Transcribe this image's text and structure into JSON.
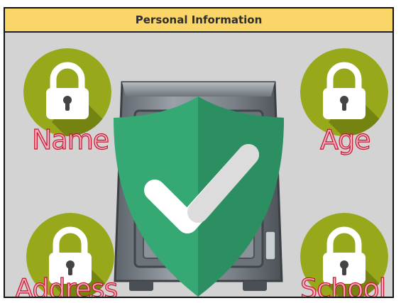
{
  "header": {
    "title": "Personal Information"
  },
  "items": [
    {
      "label": "Name",
      "icon": "padlock-icon"
    },
    {
      "label": "Age",
      "icon": "padlock-icon"
    },
    {
      "label": "Address",
      "icon": "padlock-icon"
    },
    {
      "label": "School",
      "icon": "padlock-icon"
    }
  ],
  "centerpiece": {
    "icon": "shield-check-icon",
    "background_icon": "safe-icon"
  },
  "colors": {
    "header_bg": "#fad567",
    "panel_bg": "#d3d3d3",
    "badge_green": "#97a81a",
    "shield_green": "#2f9e6c",
    "label_fill": "#f6a9bd",
    "label_stroke": "#c2182e"
  }
}
